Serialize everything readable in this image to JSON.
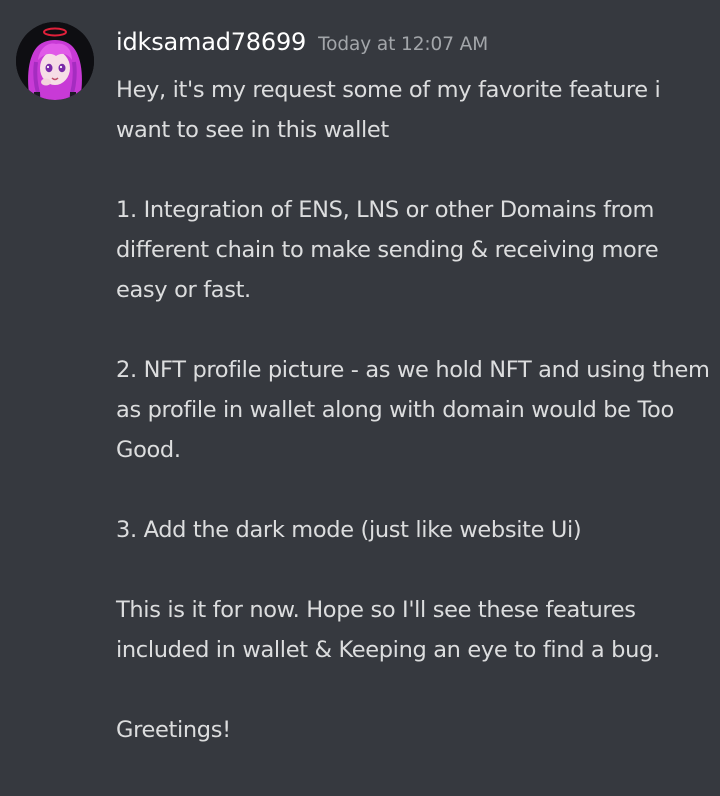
{
  "message": {
    "username": "idksamad78699",
    "timestamp": "Today at 12:07 AM",
    "paragraphs": [
      "Hey, it's my request some of my favorite feature i want to see in this wallet",
      "1.  Integration of ENS, LNS or other Domains from different chain to make sending & receiving more easy or fast.",
      "2. NFT profile picture - as we hold NFT and using them as profile in wallet along with domain would be Too Good.",
      "3.  Add the dark mode (just like website Ui)",
      "This is it for now. Hope so I'll see these features included in wallet & Keeping an eye to find a bug.",
      "Greetings!"
    ]
  },
  "colors": {
    "background": "#36393f",
    "username": "#ffffff",
    "timestamp": "#a3a6aa",
    "text": "#dcddde"
  },
  "avatar": {
    "icon": "avatar-anime-girl-pink-hair"
  }
}
